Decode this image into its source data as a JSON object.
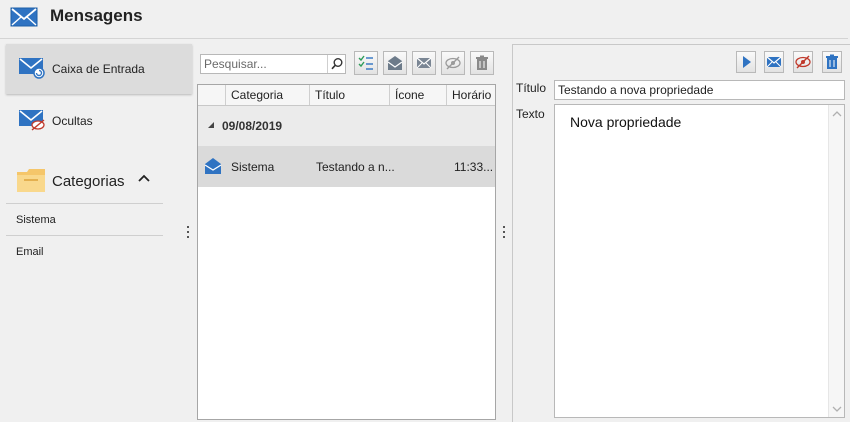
{
  "app": {
    "title": "Mensagens"
  },
  "nav": {
    "items": [
      {
        "label": "Caixa de Entrada",
        "icon": "inbox-mail-icon",
        "selected": true
      },
      {
        "label": "Ocultas",
        "icon": "hidden-mail-icon",
        "selected": false
      }
    ],
    "categories": {
      "label": "Categorias",
      "icon": "folder-icon",
      "expanded": true,
      "items": [
        "Sistema",
        "Email"
      ]
    }
  },
  "list": {
    "search": {
      "placeholder": "Pesquisar..."
    },
    "toolbar": [
      "select-all-icon",
      "open-mail-icon",
      "mail-icon",
      "hide-icon",
      "trash-icon"
    ],
    "columns": [
      "Categoria",
      "Título",
      "Ícone",
      "Horário"
    ],
    "group": {
      "date": "09/08/2019"
    },
    "rows": [
      {
        "categoria": "Sistema",
        "titulo": "Testando a n...",
        "horario": "11:33..."
      }
    ]
  },
  "detail": {
    "titulo_label": "Título",
    "texto_label": "Texto",
    "titulo_value": "Testando a nova propriedade",
    "texto_value": "Nova propriedade"
  },
  "colors": {
    "accent": "#2a6db5",
    "selected_row": "#dadada",
    "group_row": "#ebebeb"
  }
}
